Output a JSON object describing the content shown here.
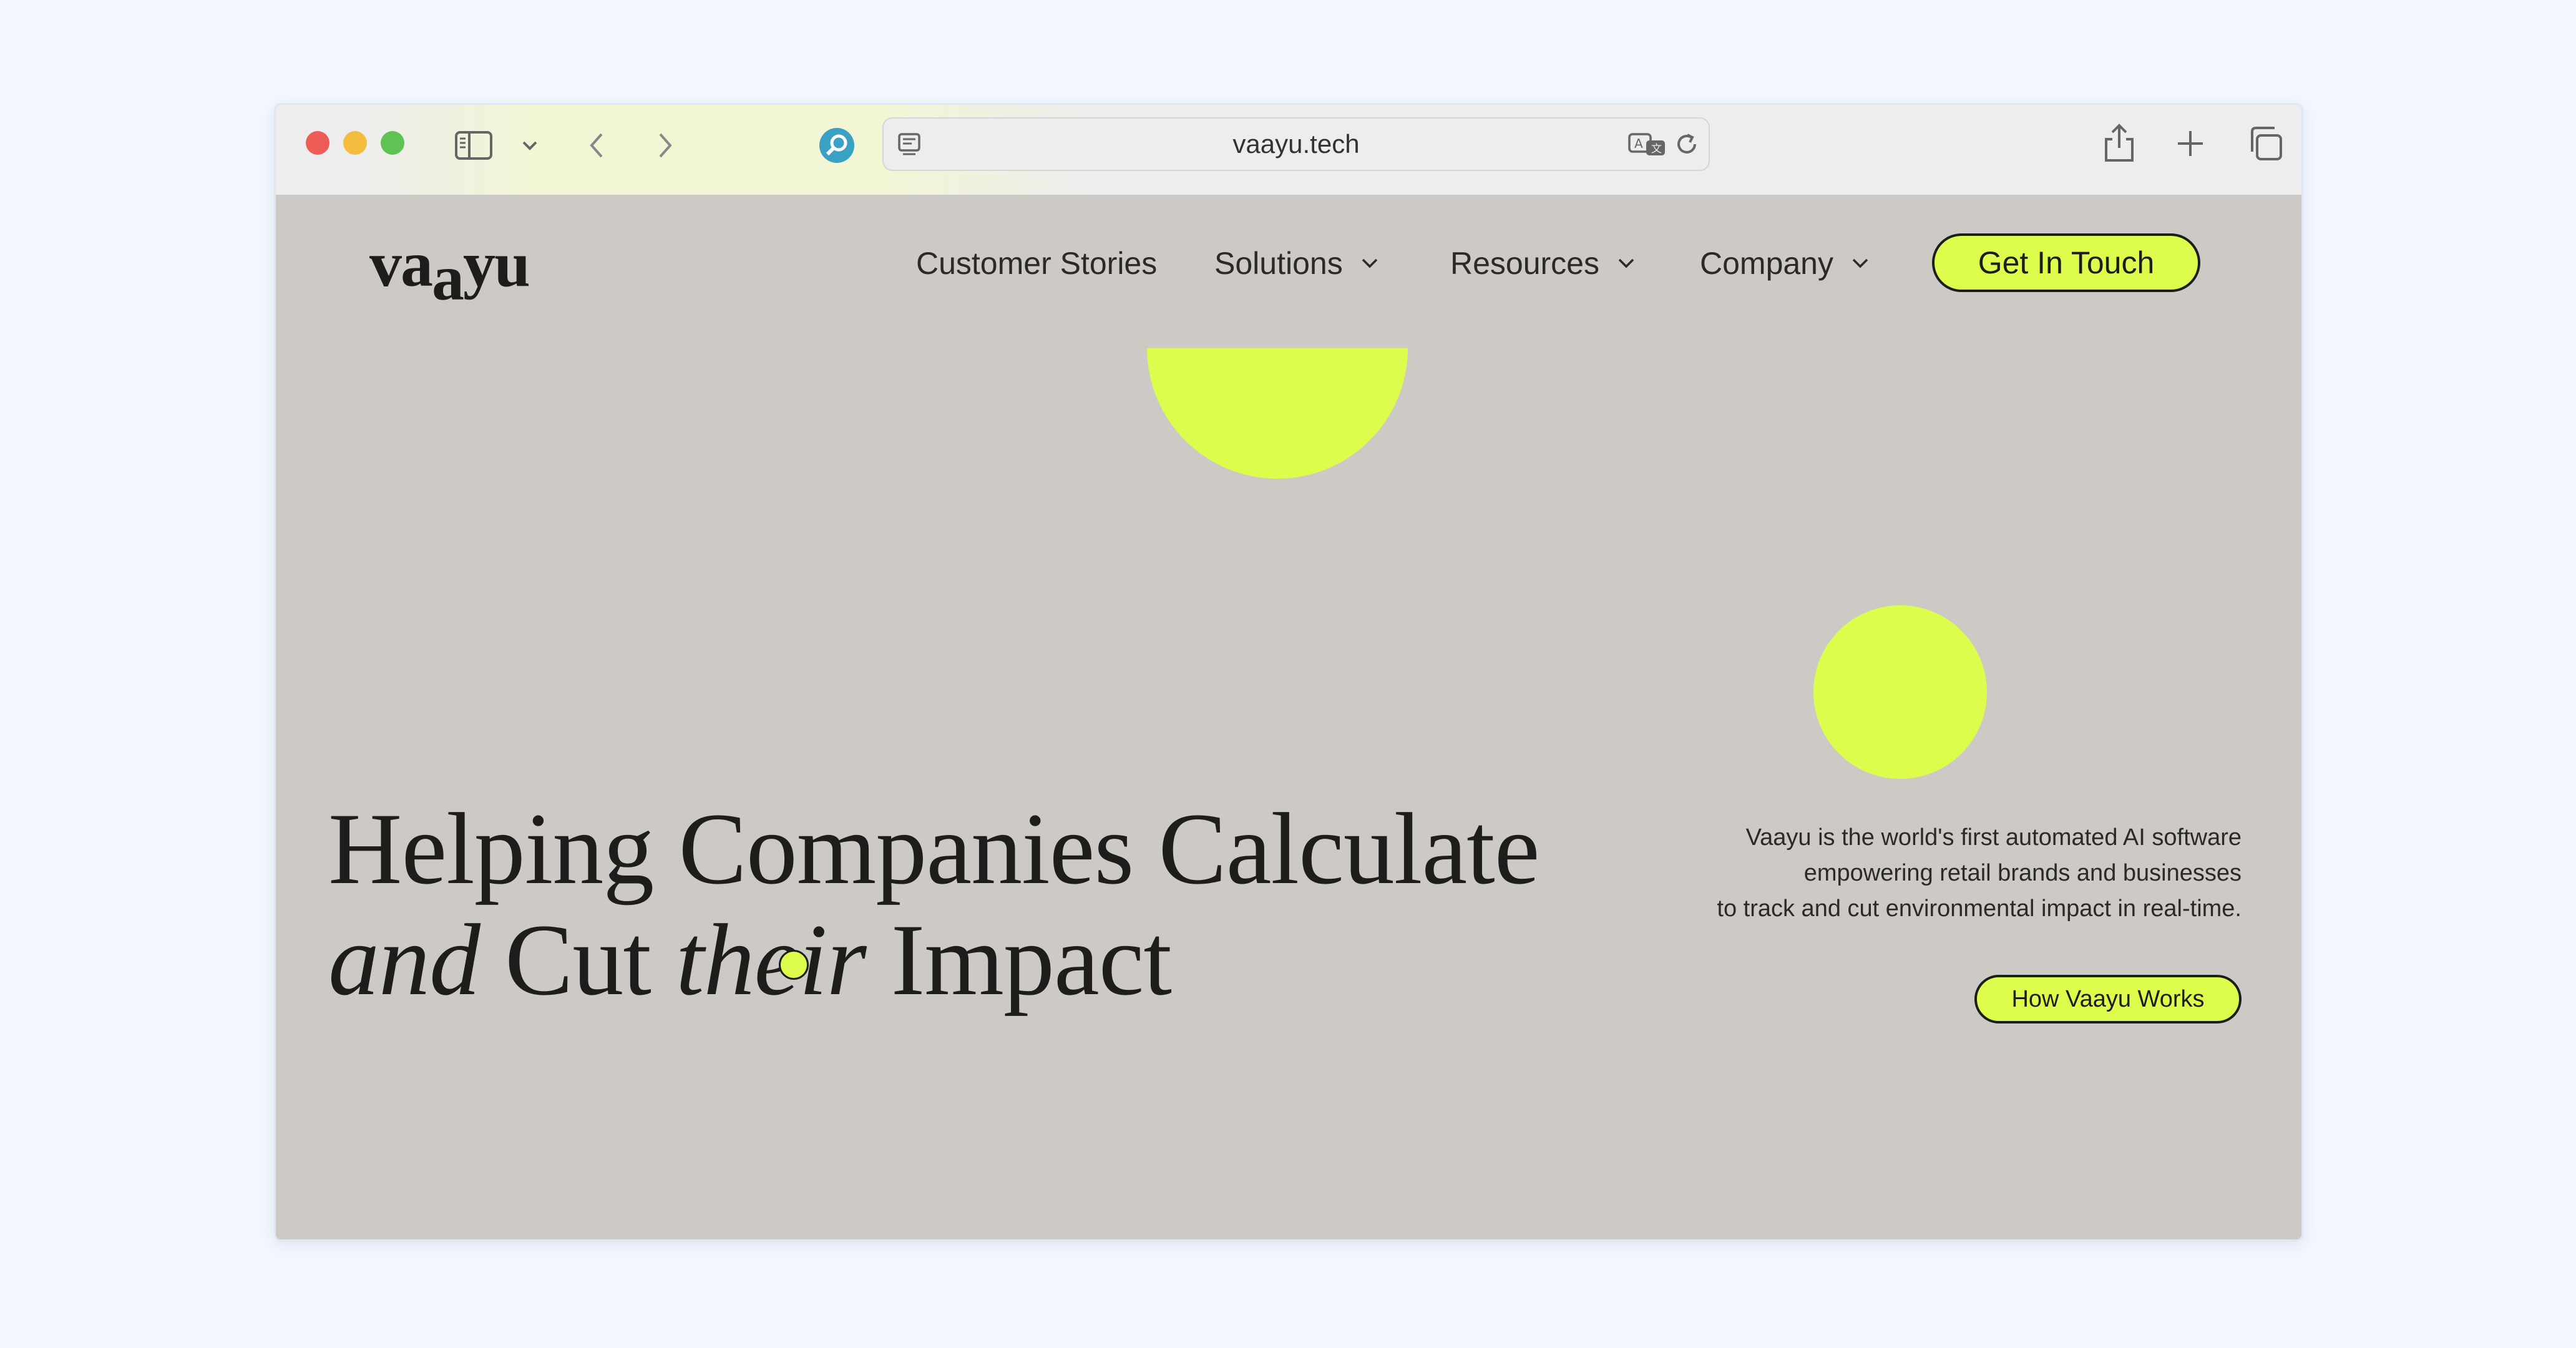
{
  "browser": {
    "url": "vaayu.tech",
    "icons": [
      "close-dot",
      "minimize-dot",
      "maximize-dot",
      "sidebar-icon",
      "chevron-down-icon",
      "back-icon",
      "forward-icon",
      "privacy-search-icon",
      "page-icon",
      "translate-icon",
      "reload-icon",
      "share-icon",
      "new-tab-icon",
      "tabs-overview-icon"
    ]
  },
  "site": {
    "logo": "vaayu",
    "nav": [
      {
        "label": "Customer Stories",
        "has_dropdown": false
      },
      {
        "label": "Solutions",
        "has_dropdown": true
      },
      {
        "label": "Resources",
        "has_dropdown": true
      },
      {
        "label": "Company",
        "has_dropdown": true
      }
    ],
    "cta_label": "Get In Touch",
    "headline": {
      "line1": "Helping Companies Calculate",
      "line2_italic_1": "and",
      "line2_normal_1": "Cut",
      "line2_italic_2": "their",
      "line2_normal_2": "Impact"
    },
    "description": [
      "Vaayu is the world's first automated AI software",
      "empowering retail brands and businesses",
      "to track and cut environmental impact in real-time."
    ],
    "secondary_cta": "How Vaayu Works"
  },
  "colors": {
    "accent": "#dcfd4b",
    "page_background": "#cdcac5",
    "text": "#1d1d1b"
  }
}
